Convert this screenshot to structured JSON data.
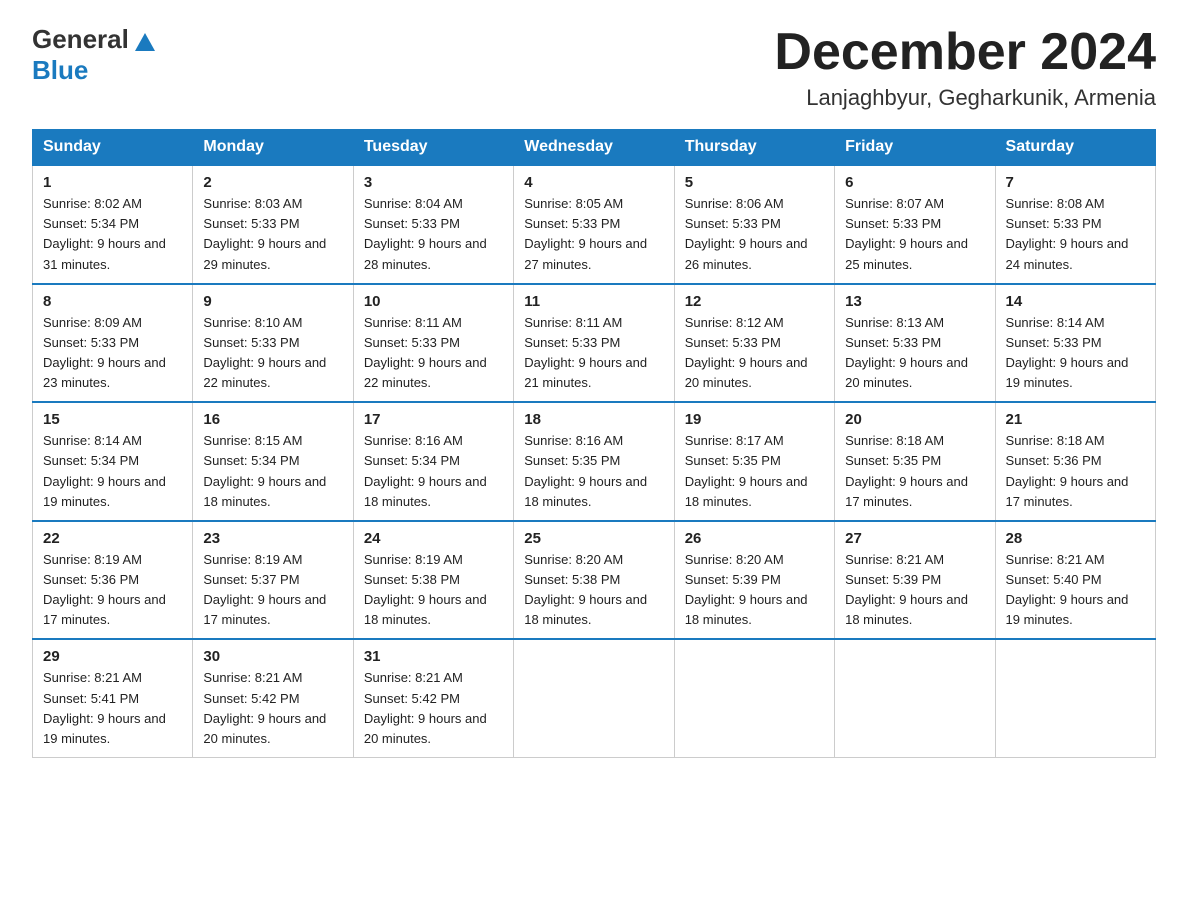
{
  "logo": {
    "general": "General",
    "blue": "Blue"
  },
  "title": "December 2024",
  "location": "Lanjaghbyur, Gegharkunik, Armenia",
  "headers": [
    "Sunday",
    "Monday",
    "Tuesday",
    "Wednesday",
    "Thursday",
    "Friday",
    "Saturday"
  ],
  "weeks": [
    [
      {
        "day": "1",
        "sunrise": "8:02 AM",
        "sunset": "5:34 PM",
        "daylight": "9 hours and 31 minutes."
      },
      {
        "day": "2",
        "sunrise": "8:03 AM",
        "sunset": "5:33 PM",
        "daylight": "9 hours and 29 minutes."
      },
      {
        "day": "3",
        "sunrise": "8:04 AM",
        "sunset": "5:33 PM",
        "daylight": "9 hours and 28 minutes."
      },
      {
        "day": "4",
        "sunrise": "8:05 AM",
        "sunset": "5:33 PM",
        "daylight": "9 hours and 27 minutes."
      },
      {
        "day": "5",
        "sunrise": "8:06 AM",
        "sunset": "5:33 PM",
        "daylight": "9 hours and 26 minutes."
      },
      {
        "day": "6",
        "sunrise": "8:07 AM",
        "sunset": "5:33 PM",
        "daylight": "9 hours and 25 minutes."
      },
      {
        "day": "7",
        "sunrise": "8:08 AM",
        "sunset": "5:33 PM",
        "daylight": "9 hours and 24 minutes."
      }
    ],
    [
      {
        "day": "8",
        "sunrise": "8:09 AM",
        "sunset": "5:33 PM",
        "daylight": "9 hours and 23 minutes."
      },
      {
        "day": "9",
        "sunrise": "8:10 AM",
        "sunset": "5:33 PM",
        "daylight": "9 hours and 22 minutes."
      },
      {
        "day": "10",
        "sunrise": "8:11 AM",
        "sunset": "5:33 PM",
        "daylight": "9 hours and 22 minutes."
      },
      {
        "day": "11",
        "sunrise": "8:11 AM",
        "sunset": "5:33 PM",
        "daylight": "9 hours and 21 minutes."
      },
      {
        "day": "12",
        "sunrise": "8:12 AM",
        "sunset": "5:33 PM",
        "daylight": "9 hours and 20 minutes."
      },
      {
        "day": "13",
        "sunrise": "8:13 AM",
        "sunset": "5:33 PM",
        "daylight": "9 hours and 20 minutes."
      },
      {
        "day": "14",
        "sunrise": "8:14 AM",
        "sunset": "5:33 PM",
        "daylight": "9 hours and 19 minutes."
      }
    ],
    [
      {
        "day": "15",
        "sunrise": "8:14 AM",
        "sunset": "5:34 PM",
        "daylight": "9 hours and 19 minutes."
      },
      {
        "day": "16",
        "sunrise": "8:15 AM",
        "sunset": "5:34 PM",
        "daylight": "9 hours and 18 minutes."
      },
      {
        "day": "17",
        "sunrise": "8:16 AM",
        "sunset": "5:34 PM",
        "daylight": "9 hours and 18 minutes."
      },
      {
        "day": "18",
        "sunrise": "8:16 AM",
        "sunset": "5:35 PM",
        "daylight": "9 hours and 18 minutes."
      },
      {
        "day": "19",
        "sunrise": "8:17 AM",
        "sunset": "5:35 PM",
        "daylight": "9 hours and 18 minutes."
      },
      {
        "day": "20",
        "sunrise": "8:18 AM",
        "sunset": "5:35 PM",
        "daylight": "9 hours and 17 minutes."
      },
      {
        "day": "21",
        "sunrise": "8:18 AM",
        "sunset": "5:36 PM",
        "daylight": "9 hours and 17 minutes."
      }
    ],
    [
      {
        "day": "22",
        "sunrise": "8:19 AM",
        "sunset": "5:36 PM",
        "daylight": "9 hours and 17 minutes."
      },
      {
        "day": "23",
        "sunrise": "8:19 AM",
        "sunset": "5:37 PM",
        "daylight": "9 hours and 17 minutes."
      },
      {
        "day": "24",
        "sunrise": "8:19 AM",
        "sunset": "5:38 PM",
        "daylight": "9 hours and 18 minutes."
      },
      {
        "day": "25",
        "sunrise": "8:20 AM",
        "sunset": "5:38 PM",
        "daylight": "9 hours and 18 minutes."
      },
      {
        "day": "26",
        "sunrise": "8:20 AM",
        "sunset": "5:39 PM",
        "daylight": "9 hours and 18 minutes."
      },
      {
        "day": "27",
        "sunrise": "8:21 AM",
        "sunset": "5:39 PM",
        "daylight": "9 hours and 18 minutes."
      },
      {
        "day": "28",
        "sunrise": "8:21 AM",
        "sunset": "5:40 PM",
        "daylight": "9 hours and 19 minutes."
      }
    ],
    [
      {
        "day": "29",
        "sunrise": "8:21 AM",
        "sunset": "5:41 PM",
        "daylight": "9 hours and 19 minutes."
      },
      {
        "day": "30",
        "sunrise": "8:21 AM",
        "sunset": "5:42 PM",
        "daylight": "9 hours and 20 minutes."
      },
      {
        "day": "31",
        "sunrise": "8:21 AM",
        "sunset": "5:42 PM",
        "daylight": "9 hours and 20 minutes."
      },
      null,
      null,
      null,
      null
    ]
  ]
}
